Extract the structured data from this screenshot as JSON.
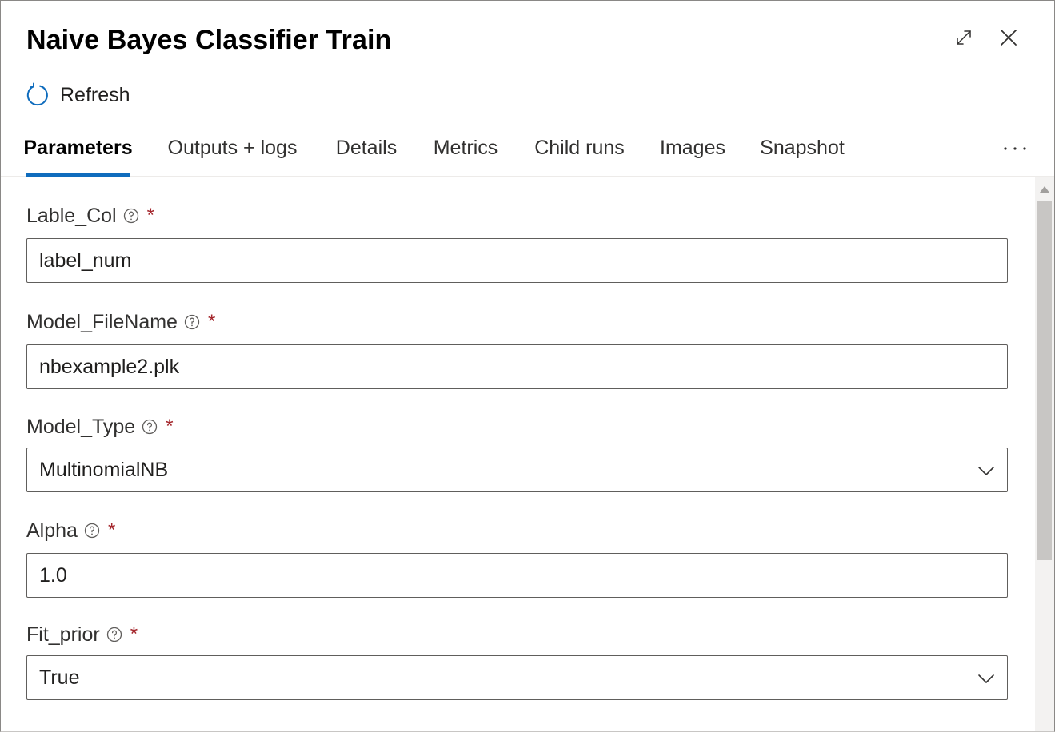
{
  "panel": {
    "title": "Naive Bayes Classifier Train",
    "expand_icon": "expand-icon",
    "close_icon": "close-icon"
  },
  "toolbar": {
    "refresh_label": "Refresh",
    "refresh_icon": "refresh-icon"
  },
  "tabs": [
    {
      "label": "Parameters",
      "active": true
    },
    {
      "label": "Outputs + logs",
      "active": false
    },
    {
      "label": "Details",
      "active": false
    },
    {
      "label": "Metrics",
      "active": false
    },
    {
      "label": "Child runs",
      "active": false
    },
    {
      "label": "Images",
      "active": false
    },
    {
      "label": "Snapshot",
      "active": false
    }
  ],
  "more_icon": "more-icon",
  "fields": [
    {
      "label": "Lable_Col",
      "required_mark": "*",
      "value": "label_num",
      "type": "text"
    },
    {
      "label": "Model_FileName",
      "required_mark": "*",
      "value": "nbexample2.plk",
      "type": "text"
    },
    {
      "label": "Model_Type",
      "required_mark": "*",
      "value": "MultinomialNB",
      "type": "dropdown"
    },
    {
      "label": "Alpha",
      "required_mark": "*",
      "value": "1.0",
      "type": "text"
    },
    {
      "label": "Fit_prior",
      "required_mark": "*",
      "value": "True",
      "type": "dropdown"
    }
  ],
  "colors": {
    "accent": "#0f6cbd",
    "required": "#a4262c",
    "border": "#605e5c"
  }
}
